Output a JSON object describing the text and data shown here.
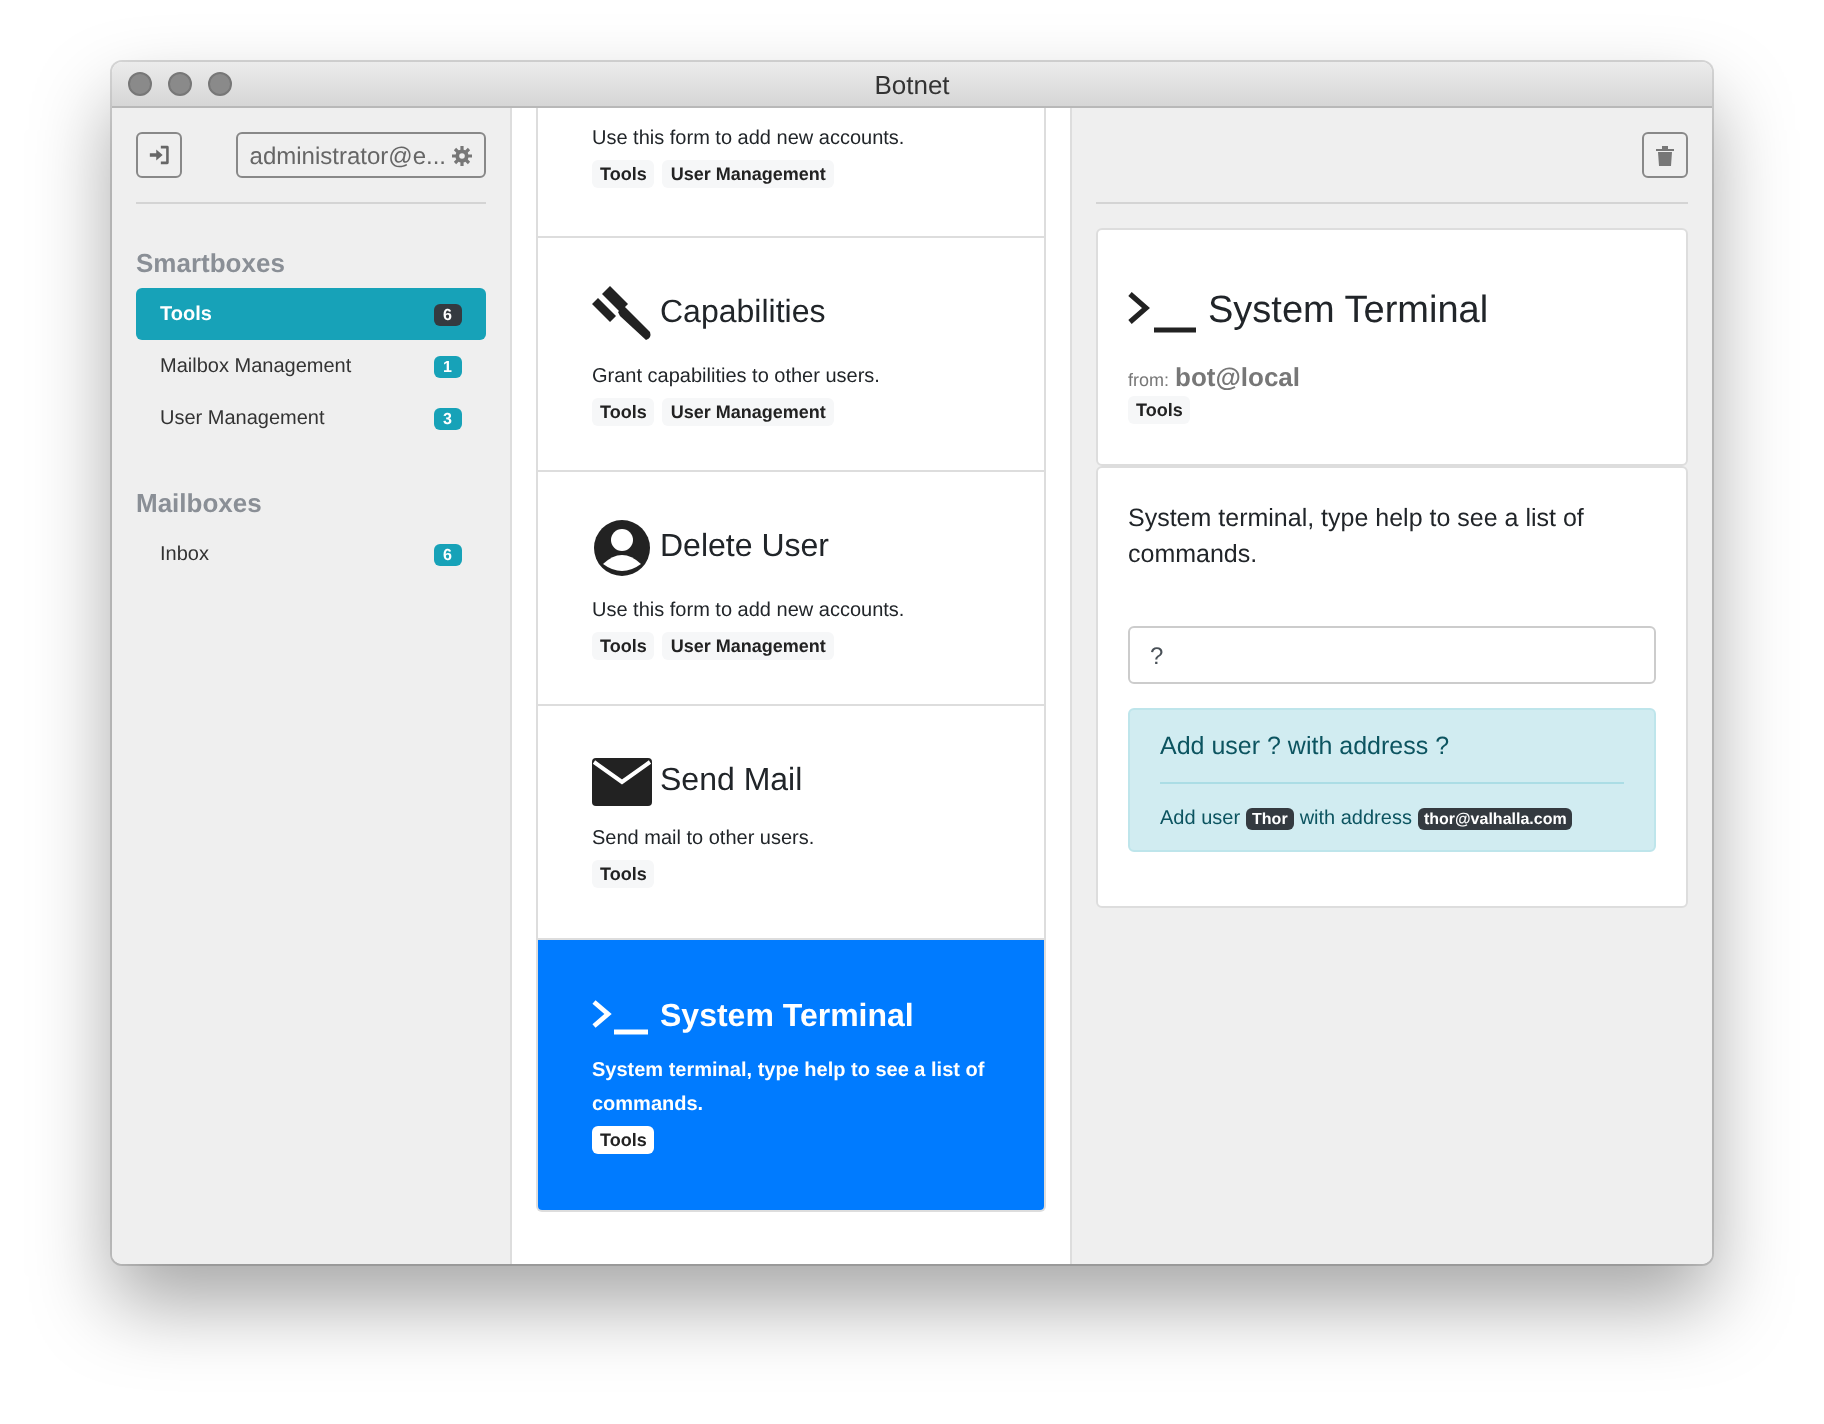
{
  "window": {
    "title": "Botnet"
  },
  "sidebar": {
    "account_button": {
      "label": "administrator@e..."
    },
    "sections": [
      {
        "title": "Smartboxes",
        "items": [
          {
            "label": "Tools",
            "count": "6",
            "selected": true
          },
          {
            "label": "Mailbox Management",
            "count": "1",
            "selected": false
          },
          {
            "label": "User Management",
            "count": "3",
            "selected": false
          }
        ]
      },
      {
        "title": "Mailboxes",
        "items": [
          {
            "label": "Inbox",
            "count": "6",
            "selected": false
          }
        ]
      }
    ]
  },
  "list": {
    "items": [
      {
        "description": "Use this form to add new accounts.",
        "tags": [
          "Tools",
          "User Management"
        ],
        "selected": false
      },
      {
        "kind": "gavel",
        "title": "Capabilities",
        "description": "Grant capabilities to other users.",
        "tags": [
          "Tools",
          "User Management"
        ],
        "selected": false
      },
      {
        "kind": "user",
        "title": "Delete User",
        "description": "Use this form to add new accounts.",
        "tags": [
          "Tools",
          "User Management"
        ],
        "selected": false
      },
      {
        "kind": "envelope",
        "title": "Send Mail",
        "description": "Send mail to other users.",
        "tags": [
          "Tools"
        ],
        "selected": false
      },
      {
        "kind": "terminal",
        "title": "System Terminal",
        "description": "System terminal, type help to see a list of commands.",
        "tags": [
          "Tools"
        ],
        "selected": true
      }
    ]
  },
  "detail": {
    "kind": "terminal",
    "title": "System Terminal",
    "from_label": "from:",
    "from": "bot@local",
    "tags": [
      "Tools"
    ],
    "description": "System terminal, type help to see a list of commands.",
    "input": {
      "value": "?"
    },
    "alert": {
      "heading": "Add user ? with address ?",
      "parts": [
        {
          "kind": "text",
          "text": "Add user"
        },
        {
          "kind": "code",
          "text": "Thor"
        },
        {
          "kind": "text",
          "text": "with address"
        },
        {
          "kind": "code",
          "text": "thor@valhalla.com"
        }
      ]
    }
  }
}
